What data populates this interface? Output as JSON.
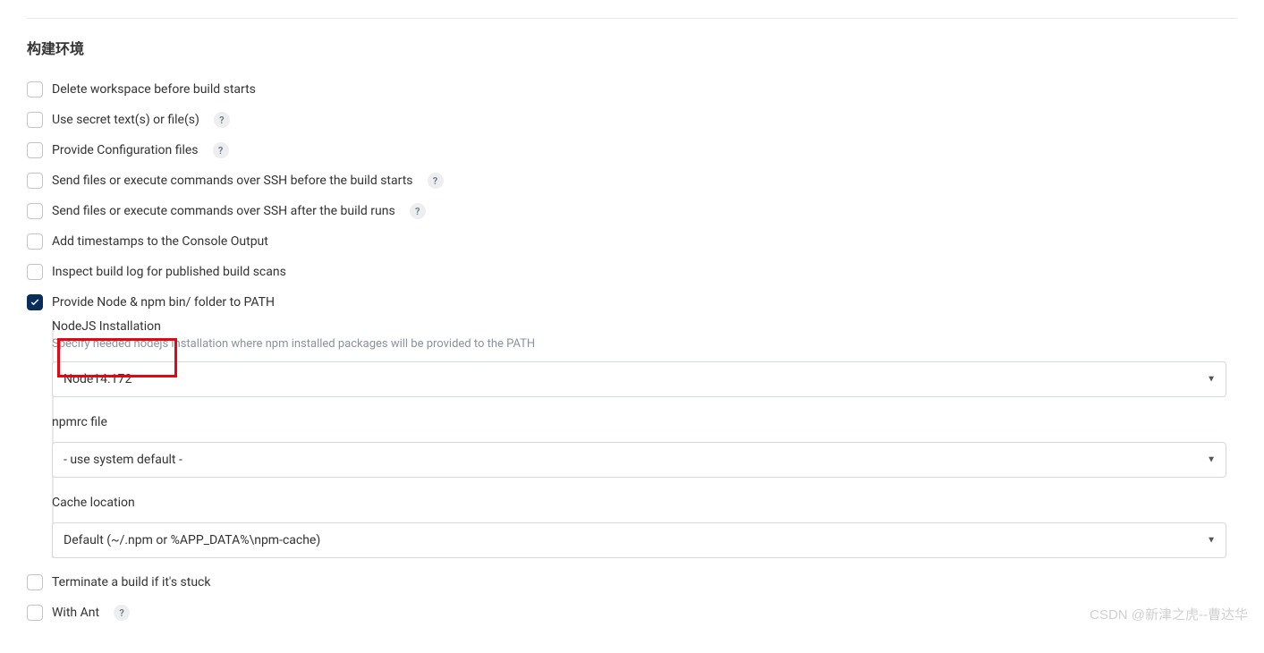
{
  "section_title": "构建环境",
  "checkboxes": {
    "delete_workspace": {
      "label": "Delete workspace before build starts",
      "checked": false,
      "has_help": false
    },
    "use_secret": {
      "label": "Use secret text(s) or file(s)",
      "checked": false,
      "has_help": true
    },
    "provide_config": {
      "label": "Provide Configuration files",
      "checked": false,
      "has_help": true
    },
    "ssh_before": {
      "label": "Send files or execute commands over SSH before the build starts",
      "checked": false,
      "has_help": true
    },
    "ssh_after": {
      "label": "Send files or execute commands over SSH after the build runs",
      "checked": false,
      "has_help": true
    },
    "add_timestamps": {
      "label": "Add timestamps to the Console Output",
      "checked": false,
      "has_help": false
    },
    "inspect_log": {
      "label": "Inspect build log for published build scans",
      "checked": false,
      "has_help": false
    },
    "provide_node": {
      "label": "Provide Node & npm bin/ folder to PATH",
      "checked": true,
      "has_help": false
    },
    "terminate_stuck": {
      "label": "Terminate a build if it's stuck",
      "checked": false,
      "has_help": false
    },
    "with_ant": {
      "label": "With Ant",
      "checked": false,
      "has_help": true
    }
  },
  "nodejs": {
    "installation_label": "NodeJS Installation",
    "installation_desc": "Specify needed nodejs installation where npm installed packages will be provided to the PATH",
    "installation_value": "Node14.172",
    "npmrc_label": "npmrc file",
    "npmrc_value": "- use system default -",
    "cache_label": "Cache location",
    "cache_value": "Default (~/.npm or %APP_DATA%\\npm-cache)"
  },
  "help_char": "?",
  "watermark": "CSDN @新津之虎--曹达华"
}
